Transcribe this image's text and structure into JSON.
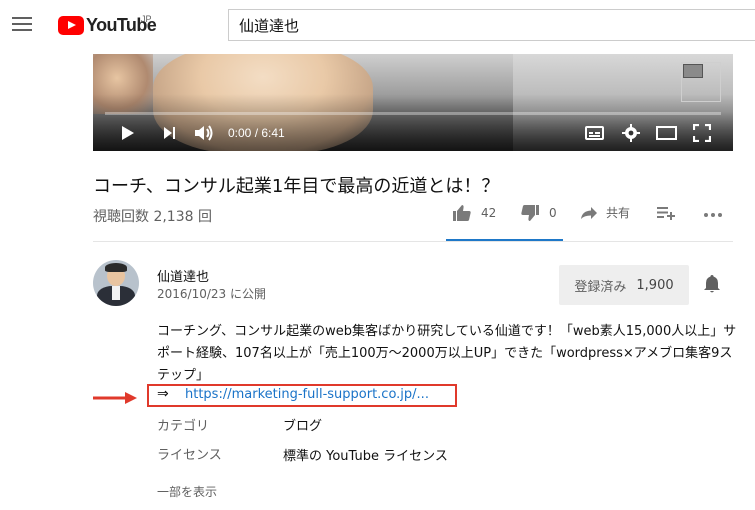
{
  "header": {
    "logo_text": "YouTube",
    "logo_region": "JP",
    "search_value": "仙道達也"
  },
  "player": {
    "time": "0:00 / 6:41",
    "progress": 0
  },
  "video": {
    "title": "コーチ、コンサル起業1年目で最高の近道とは！？",
    "views": "視聴回数 2,138 回",
    "likes": "42",
    "dislikes": "0",
    "share_label": "共有"
  },
  "channel": {
    "name": "仙道達也",
    "published": "2016/10/23 に公開",
    "subscribe_label": "登録済み",
    "subscriber_count": "1,900"
  },
  "description": {
    "text": "コーチング、コンサル起業のweb集客ばかり研究している仙道です！「web素人15,000人以上」サポート経験、107名以上が「売上100万〜2000万以上UP」できた「wordpress×アメブロ集客9ステップ」",
    "arrow": "⇒",
    "link": "https://marketing-full-support.co.jp/..."
  },
  "meta": [
    {
      "key": "カテゴリ",
      "value": "ブログ"
    },
    {
      "key": "ライセンス",
      "value": "標準の YouTube ライセンス"
    }
  ],
  "show_more": "一部を表示",
  "colors": {
    "brand_red": "#ff0000",
    "link_blue": "#1a73c8",
    "highlight_red": "#e0392b",
    "like_accent": "#1e78c8"
  }
}
